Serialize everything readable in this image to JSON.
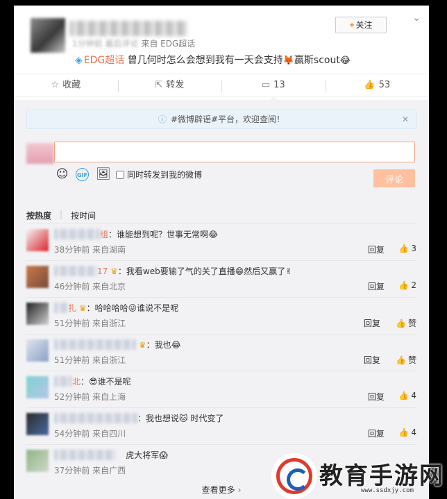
{
  "post": {
    "follow_label": "关注",
    "meta_prefix": "1分钟前",
    "meta_latest": "最后评论",
    "meta_source": "来自 EDG超话",
    "topic": "EDG超话",
    "text": "曾几何时怎么会想到我有一天会支持",
    "text_tail": "赢斯scout"
  },
  "actions": {
    "favorite": "收藏",
    "repost": "转发",
    "comments": "13",
    "likes": "53"
  },
  "notice": {
    "text": "#微博辟谣#平台，欢迎查阅！"
  },
  "composer": {
    "placeholder": "",
    "repost_label": "同时转发到我的微博",
    "submit_label": "评论"
  },
  "sort": {
    "hot": "按热度",
    "time": "按时间"
  },
  "comments": [
    {
      "nick_tail": "组",
      "text": "：谁能想到呢？世事无常啊",
      "emoji": "😂",
      "time": "38分钟前",
      "source": "来自湖南",
      "reply": "回复",
      "likes": "3"
    },
    {
      "nick_tail": "17",
      "text": "：我看web要输了气的关了直播",
      "emoji": "😁",
      "text2": "然后又赢了",
      "emoji2": "✌",
      "time": "46分钟前",
      "source": "来自北京",
      "reply": "回复",
      "likes": "2"
    },
    {
      "nick_tail": "扎",
      "text": "：哈哈哈哈",
      "emoji": "😜",
      "text2": "谁说不是呢",
      "time": "51分钟前",
      "source": "来自浙江",
      "reply": "回复",
      "likes": "赞"
    },
    {
      "nick_tail": "",
      "text": "：我也",
      "emoji": "😂",
      "time": "51分钟前",
      "source": "来自浙江",
      "reply": "回复",
      "likes": "赞"
    },
    {
      "nick_tail": "北",
      "text": "谁不是呢",
      "emoji": "😎",
      "time": "52分钟前",
      "source": "来自上海",
      "reply": "回复",
      "likes": "4"
    },
    {
      "nick_tail": "",
      "text": "：我也想说",
      "emoji": "🐱",
      "text2": "时代变了",
      "time": "54分钟前",
      "source": "来自四川",
      "reply": "回复",
      "likes": "4"
    },
    {
      "nick_tail": "",
      "text": "虎大将军",
      "emoji": "😱",
      "time": "37分钟前",
      "source": "来自广西",
      "reply": "",
      "likes": ""
    }
  ],
  "more_label": "查看更多",
  "watermark": {
    "text": "教育手游网",
    "url": "www.ssdxjy.com"
  }
}
